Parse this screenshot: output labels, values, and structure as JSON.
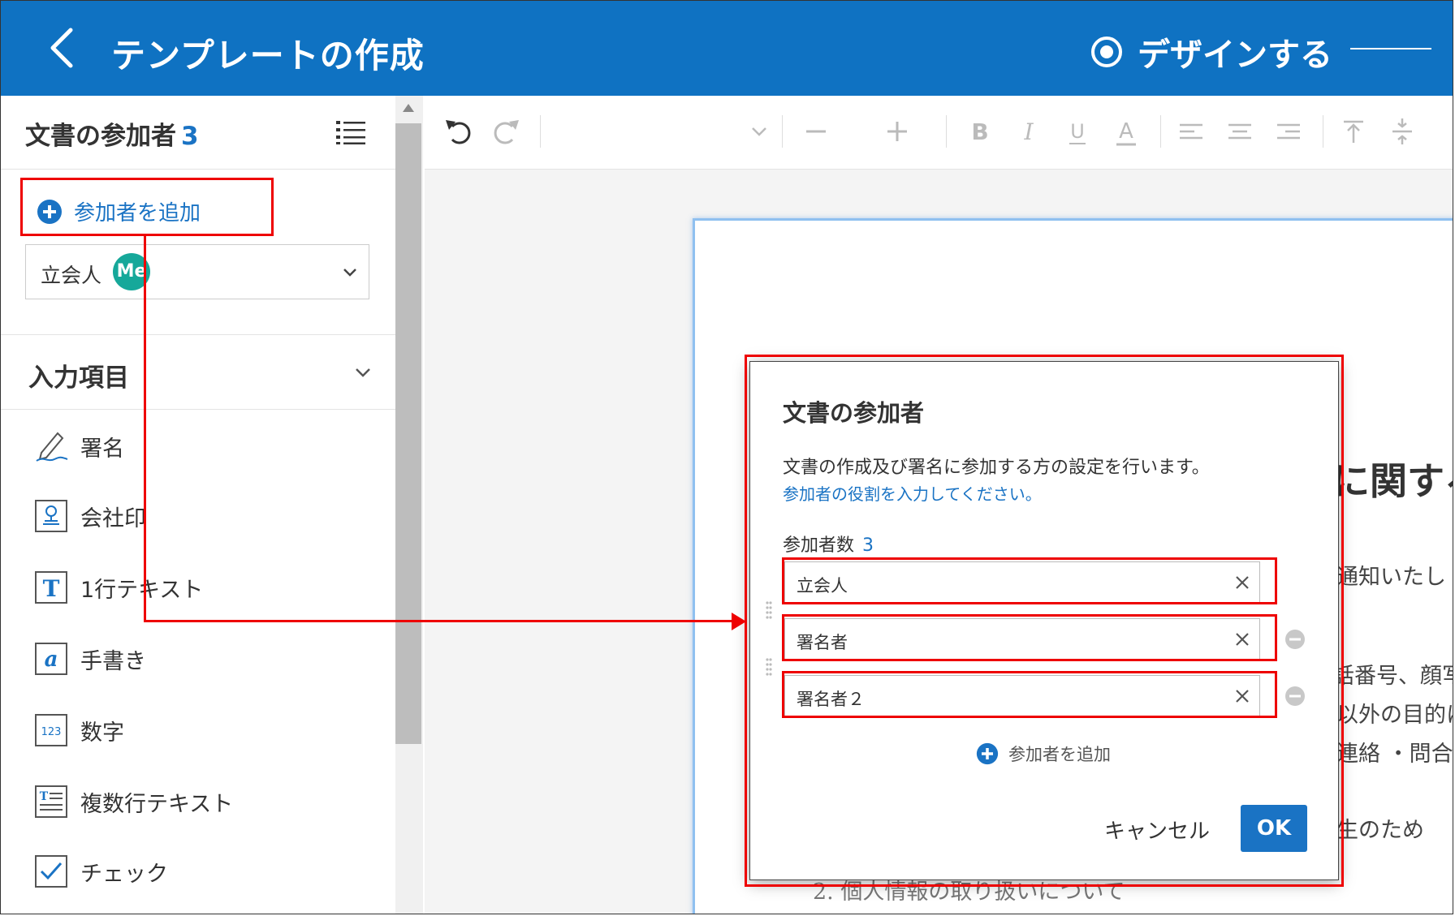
{
  "header": {
    "title": "テンプレートの作成",
    "step_label": "デザインする",
    "color": "#0f72c2"
  },
  "sidebar": {
    "participants_title": "文書の参加者",
    "participants_count": "3",
    "add_participant_label": "参加者を追加",
    "selected_participant": "立会人",
    "avatar_initials": "Me",
    "avatar_color": "#16a89a",
    "input_section_title": "入力項目",
    "fields": [
      {
        "label": "署名",
        "icon": "signature-pen-icon"
      },
      {
        "label": "会社印",
        "icon": "company-seal-icon"
      },
      {
        "label": "1行テキスト",
        "icon": "text-T-icon"
      },
      {
        "label": "手書き",
        "icon": "handwriting-icon"
      },
      {
        "label": "数字",
        "icon": "number-123-icon"
      },
      {
        "label": "複数行テキスト",
        "icon": "multiline-text-icon"
      },
      {
        "label": "チェック",
        "icon": "checkbox-icon"
      }
    ]
  },
  "toolbar": {
    "tools": [
      "undo-icon",
      "redo-icon",
      "chevron-down-icon",
      "minus-icon",
      "plus-icon",
      "bold-icon",
      "italic-icon",
      "underline-icon",
      "font-color-icon",
      "align-left-icon",
      "align-center-icon",
      "align-right-icon",
      "valign-top-icon",
      "valign-middle-icon"
    ]
  },
  "document": {
    "title_fragment": "に関する",
    "text_fragments": [
      "通知いたし",
      "話番号、顔写",
      "以外の目的に",
      "連絡 ・問合せ",
      "生のため",
      "2. 個人情報の取り扱いについて"
    ]
  },
  "modal": {
    "title": "文書の参加者",
    "description": "文書の作成及び署名に参加する方の設定を行います。",
    "hint": "参加者の役割を入力してください。",
    "count_label": "参加者数",
    "count_value": "3",
    "roles": [
      "立会人",
      "署名者",
      "署名者２"
    ],
    "add_label": "参加者を追加",
    "cancel_label": "キャンセル",
    "ok_label": "OK",
    "accent": "#1a73c4"
  },
  "annotation_color": "#e00000"
}
